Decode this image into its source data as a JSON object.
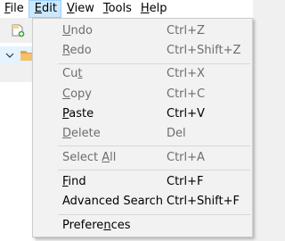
{
  "menubar": {
    "items": [
      {
        "pre": "",
        "key": "F",
        "post": "ile"
      },
      {
        "pre": "",
        "key": "E",
        "post": "dit"
      },
      {
        "pre": "",
        "key": "V",
        "post": "iew"
      },
      {
        "pre": "",
        "key": "T",
        "post": "ools"
      },
      {
        "pre": "",
        "key": "H",
        "post": "elp"
      }
    ]
  },
  "icons": {
    "new_document": "new-document-icon",
    "expand": "chevron-down-icon",
    "folder": "folder-icon"
  },
  "colors": {
    "menubar_active_bg": "#cce8ff",
    "menubar_active_border": "#99d1ff",
    "dropdown_bg": "#f2f2f2",
    "disabled_text": "#6d6d6d",
    "tree_selection": "#e5f3ff",
    "folder": "#e8a33c"
  },
  "edit_menu": {
    "undo": {
      "pre": "",
      "key": "U",
      "post": "ndo",
      "shortcut": "Ctrl+Z",
      "enabled": false
    },
    "redo": {
      "pre": "",
      "key": "R",
      "post": "edo",
      "shortcut": "Ctrl+Shift+Z",
      "enabled": false
    },
    "cut": {
      "pre": "Cu",
      "key": "t",
      "post": "",
      "shortcut": "Ctrl+X",
      "enabled": false
    },
    "copy": {
      "pre": "",
      "key": "C",
      "post": "opy",
      "shortcut": "Ctrl+C",
      "enabled": false
    },
    "paste": {
      "pre": "",
      "key": "P",
      "post": "aste",
      "shortcut": "Ctrl+V",
      "enabled": true
    },
    "delete": {
      "pre": "",
      "key": "D",
      "post": "elete",
      "shortcut": "Del",
      "enabled": false
    },
    "select_all": {
      "pre": "Select ",
      "key": "A",
      "post": "ll",
      "shortcut": "Ctrl+A",
      "enabled": false
    },
    "find": {
      "pre": "",
      "key": "F",
      "post": "ind",
      "shortcut": "Ctrl+F",
      "enabled": true
    },
    "advanced_search": {
      "pre": "Advanced Search",
      "key": "",
      "post": "",
      "shortcut": "Ctrl+Shift+F",
      "enabled": true
    },
    "preferences": {
      "pre": "Prefere",
      "key": "n",
      "post": "ces",
      "shortcut": "",
      "enabled": true
    }
  }
}
